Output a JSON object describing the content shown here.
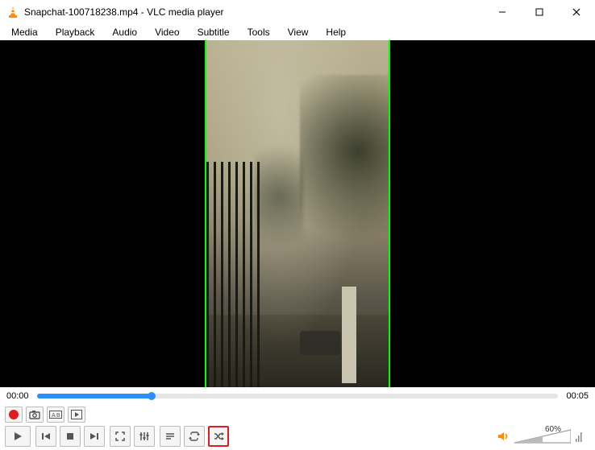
{
  "window": {
    "title": "Snapchat-100718238.mp4 - VLC media player"
  },
  "menu": {
    "items": [
      "Media",
      "Playback",
      "Audio",
      "Video",
      "Subtitle",
      "Tools",
      "View",
      "Help"
    ]
  },
  "playback": {
    "current_time": "00:00",
    "duration": "00:05"
  },
  "volume": {
    "percent_label": "60%"
  }
}
